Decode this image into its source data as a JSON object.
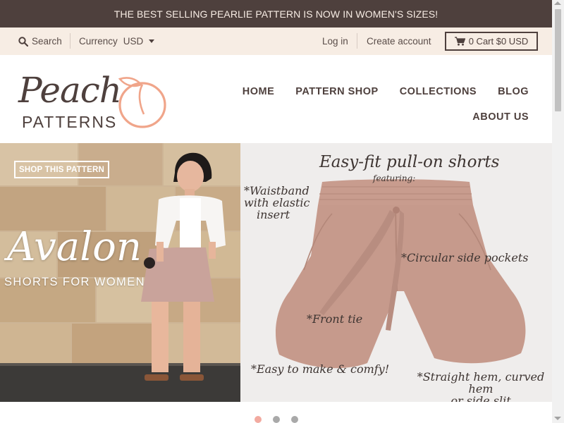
{
  "announcement": "THE BEST SELLING PEARLIE PATTERN IS NOW IN WOMEN'S SIZES!",
  "util": {
    "search": "Search",
    "currency_label": "Currency",
    "currency_value": "USD",
    "login": "Log in",
    "create_account": "Create account",
    "cart": "0 Cart $0 USD"
  },
  "logo": {
    "line1": "Peach",
    "line2": "PATTERNS"
  },
  "nav": {
    "items": [
      "HOME",
      "PATTERN SHOP",
      "COLLECTIONS",
      "BLOG",
      "ABOUT US"
    ]
  },
  "hero": {
    "button": "SHOP THIS PATTERN",
    "title": "Avalon",
    "subtitle": "SHORTS FOR WOMEN",
    "headline": "Easy-fit pull-on shorts",
    "featuring": "featuring:",
    "annotations": {
      "waistband": [
        "*Waistband",
        "with elastic",
        "insert"
      ],
      "pockets": "*Circular side pockets",
      "tie": "*Front tie",
      "easy": "*Easy to make & comfy!",
      "hem": [
        "*Straight hem, curved hem",
        "or side slit"
      ]
    }
  },
  "slider": {
    "active_index": 0,
    "count": 3
  },
  "colors": {
    "announcement_bg": "#4e403d",
    "util_bg": "#f7ede4",
    "peach": "#f0a58a",
    "short_fabric": "#c59a8d"
  }
}
